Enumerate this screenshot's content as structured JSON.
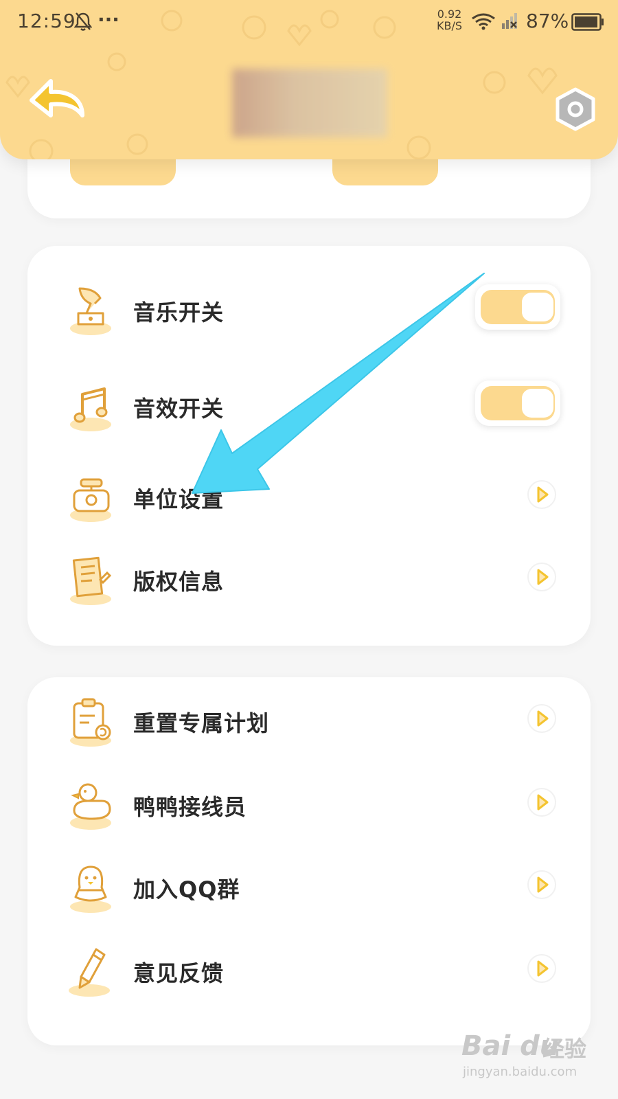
{
  "status_bar": {
    "time": "12:59",
    "more": "···",
    "speed_value": "0.92",
    "speed_unit": "KB/S",
    "battery": "87%"
  },
  "header": {
    "bg_color": "#fcd98f"
  },
  "settings_card": {
    "items": [
      {
        "label": "音乐开关",
        "icon": "gramophone-icon",
        "control": "toggle",
        "on": true
      },
      {
        "label": "音效开关",
        "icon": "music-note-icon",
        "control": "toggle",
        "on": true
      },
      {
        "label": "单位设置",
        "icon": "scale-icon",
        "control": "chevron"
      },
      {
        "label": "版权信息",
        "icon": "document-pen-icon",
        "control": "chevron"
      }
    ]
  },
  "more_card": {
    "items": [
      {
        "label": "重置专属计划",
        "icon": "clipboard-reset-icon",
        "control": "chevron"
      },
      {
        "label": "鸭鸭接线员",
        "icon": "duck-icon",
        "control": "chevron"
      },
      {
        "label": "加入QQ群",
        "icon": "penguin-icon",
        "control": "chevron"
      },
      {
        "label": "意见反馈",
        "icon": "pencil-icon",
        "control": "chevron"
      }
    ]
  },
  "annotation": {
    "color": "#4fd6f5"
  },
  "watermark": {
    "brand": "Bai du",
    "brand_cn": "经验",
    "url": "jingyan.baidu.com"
  }
}
